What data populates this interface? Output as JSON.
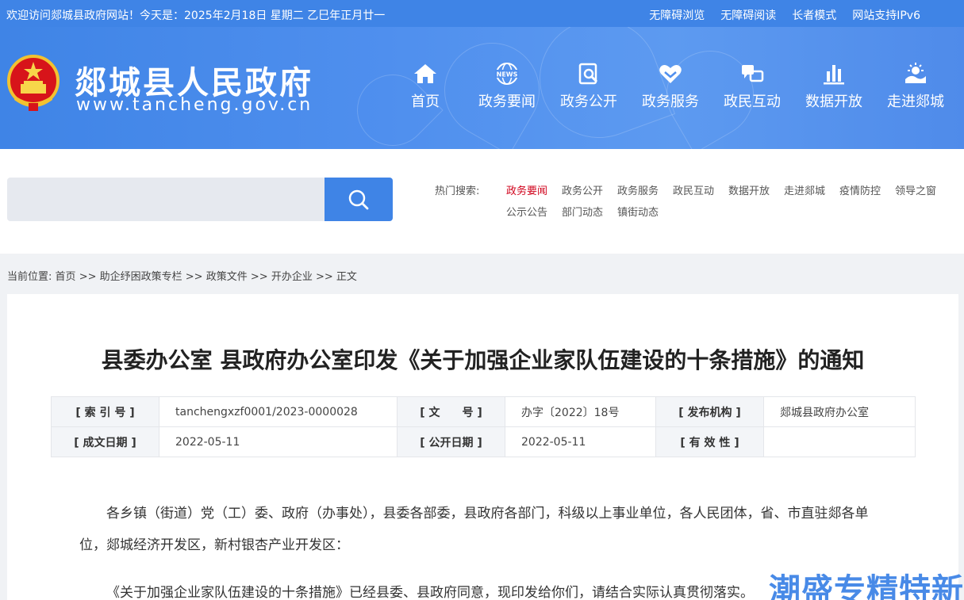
{
  "topbar": {
    "welcome": "欢迎访问郯城县政府网站！今天是：2025年2月18日   星期二   乙巳年正月廿一",
    "links": [
      "无障碍浏览",
      "无障碍阅读",
      "长者模式",
      "网站支持IPv6"
    ]
  },
  "header": {
    "title": "郯城县人民政府",
    "url": "www.tancheng.gov.cn"
  },
  "nav": [
    {
      "label": "首页",
      "icon": "home-icon"
    },
    {
      "label": "政务要闻",
      "icon": "news-icon",
      "badge": "NEWS"
    },
    {
      "label": "政务公开",
      "icon": "document-search-icon"
    },
    {
      "label": "政务服务",
      "icon": "heart-hands-icon"
    },
    {
      "label": "政民互动",
      "icon": "chat-bubbles-icon"
    },
    {
      "label": "数据开放",
      "icon": "bar-chart-icon"
    },
    {
      "label": "走进郯城",
      "icon": "sun-landscape-icon"
    }
  ],
  "search": {
    "placeholder": "",
    "hot_label": "热门搜索:",
    "hot_items": [
      "政务要闻",
      "政务公开",
      "政务服务",
      "政民互动",
      "数据开放",
      "走进郯城",
      "疫情防控",
      "领导之窗",
      "公示公告",
      "部门动态",
      "镇街动态"
    ],
    "active_color": "#d0021b"
  },
  "breadcrumb": {
    "prefix": "当前位置:",
    "items": [
      "首页",
      "助企纾困政策专栏",
      "政策文件",
      "开办企业",
      "正文"
    ],
    "separator": ">>"
  },
  "article": {
    "title": "县委办公室 县政府办公室印发《关于加强企业家队伍建设的十条措施》的通知",
    "meta": {
      "index_label": "[ 索 引 号 ]",
      "index_value": "tanchengxzf0001/2023-0000028",
      "doc_no_label": "[ 文　　号 ]",
      "doc_no_value": "办字〔2022〕18号",
      "publisher_label": "[ 发布机构 ]",
      "publisher_value": "郯城县政府办公室",
      "created_label": "[ 成文日期 ]",
      "created_value": "2022-05-11",
      "published_label": "[ 公开日期 ]",
      "published_value": "2022-05-11",
      "validity_label": "[ 有 效 性 ]",
      "validity_value": ""
    },
    "para1": "各乡镇（街道）党（工）委、政府（办事处），县委各部委，县政府各部门，科级以上事业单位，各人民团体，省、市直驻郯各单位，郯城经济开发区，新村银杏产业开发区：",
    "para2": "《关于加强企业家队伍建设的十条措施》已经县委、县政府同意，现印发给你们，请结合实际认真贯彻落实。"
  },
  "watermark": "潮盛专精特新",
  "colors": {
    "primary": "#3f84e6",
    "page_bg": "#f0f2f5"
  }
}
